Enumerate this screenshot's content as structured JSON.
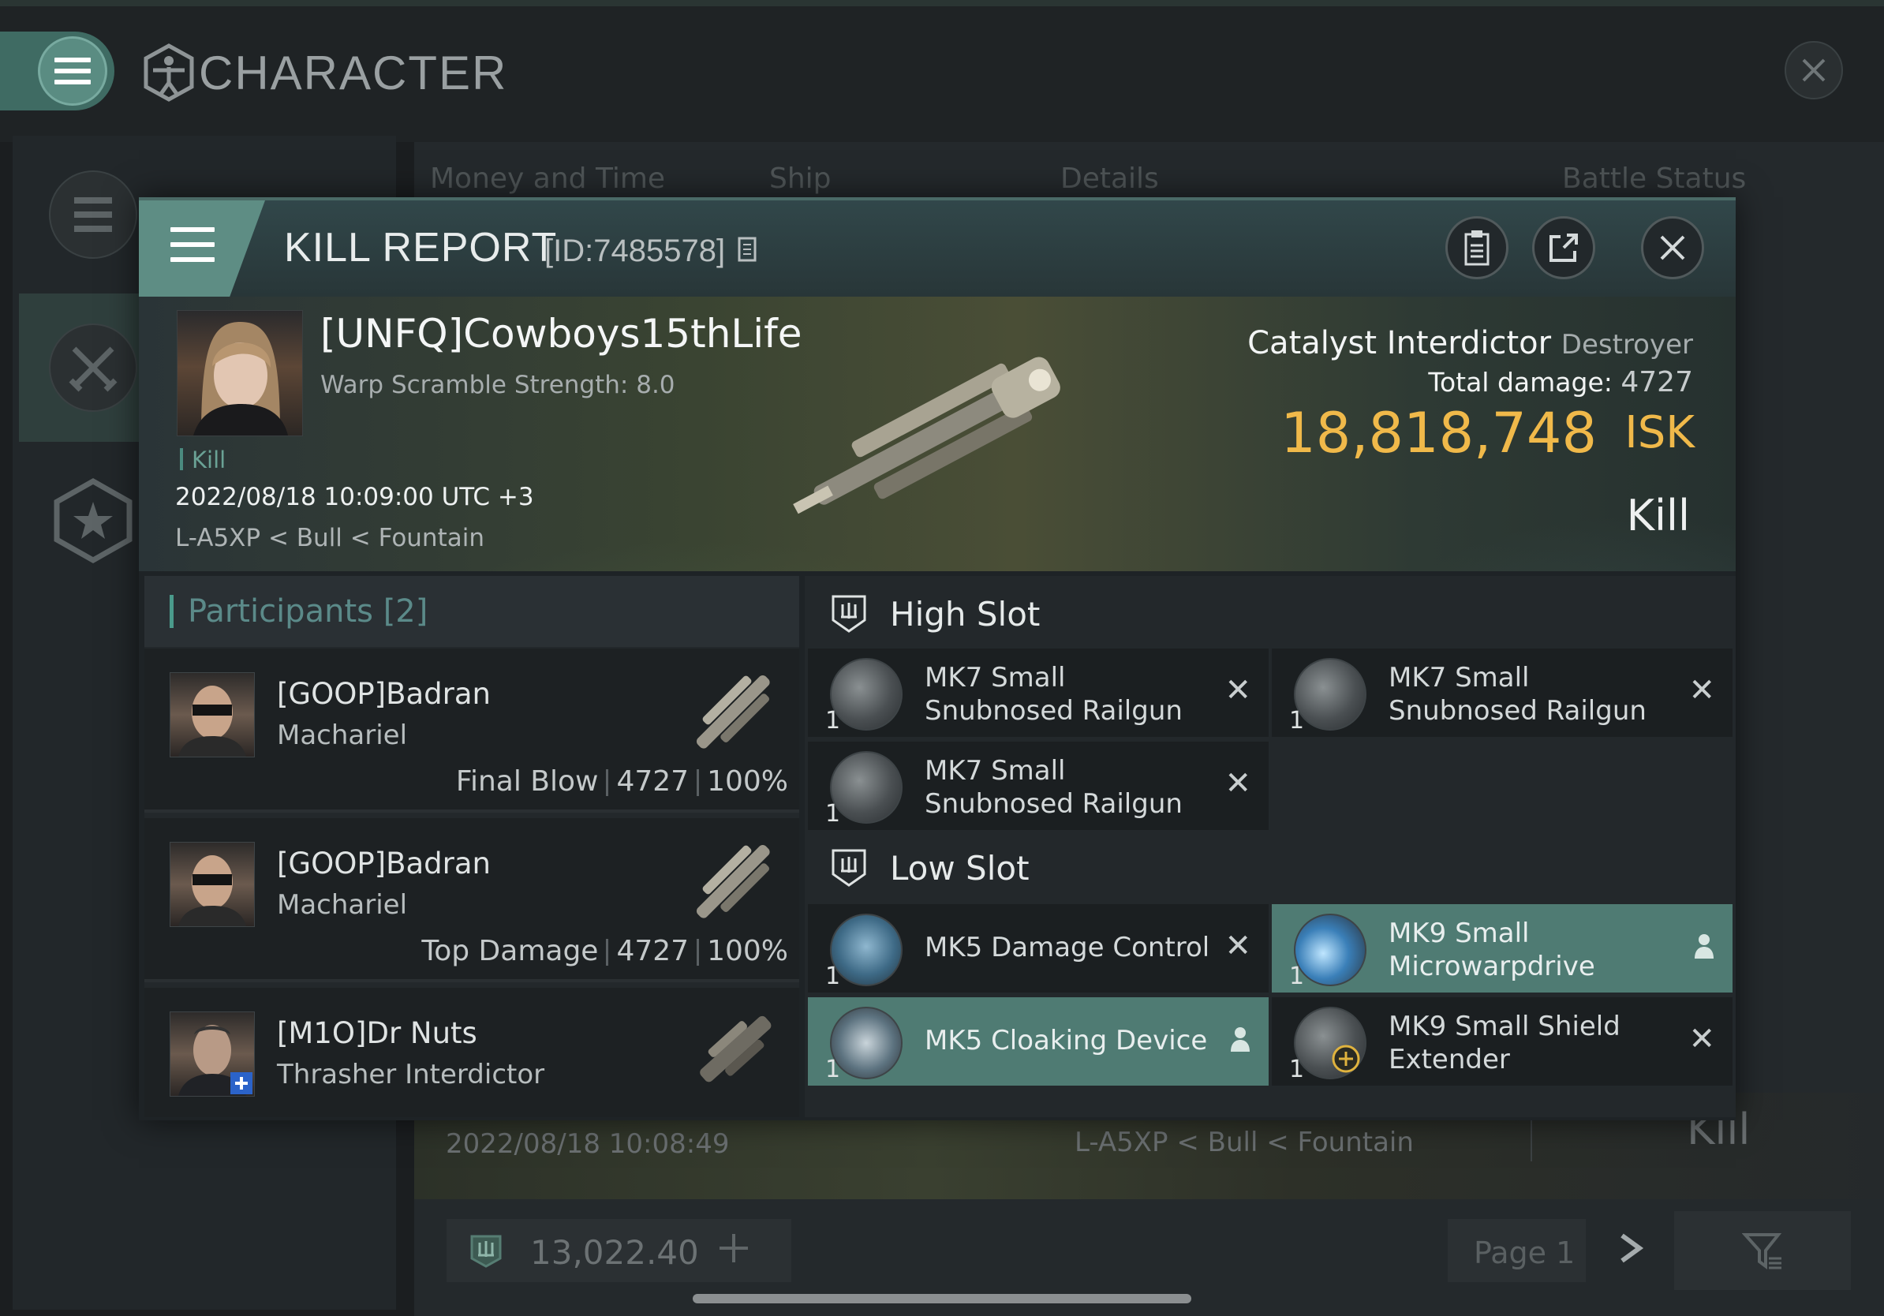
{
  "app": {
    "title": "CHARACTER",
    "tabs": [
      "Money and Time",
      "Ship",
      "Details",
      "Battle Status"
    ],
    "background_row": {
      "date": "2022/08/18  10:08:49",
      "location": "L-A5XP < Bull < Fountain",
      "status": "Kill"
    },
    "balance": "13,022.40",
    "page_label": "Page 1",
    "icons": {
      "menu": "hamburger-icon",
      "logo": "vitruvian-man-icon",
      "close": "close-icon",
      "list": "list-icon",
      "swords": "crossed-swords-icon",
      "star": "star-badge-icon",
      "balance": "wallet-icon",
      "add": "plus-icon",
      "next": "chevron-right-icon",
      "filter": "filter-icon"
    }
  },
  "kill_report": {
    "title": "KILL REPORT",
    "id_label": "[ID:7485578]",
    "victim": {
      "name": "[UNFQ]Cowboys15thLife",
      "warp_scramble": "Warp Scramble Strength: 8.0",
      "tag": "Kill",
      "datetime": "2022/08/18 10:09:00 UTC +3",
      "location": "L-A5XP < Bull < Fountain",
      "ship_name": "Catalyst Interdictor",
      "ship_class": "Destroyer",
      "total_damage_label": "Total damage:",
      "total_damage": "4727",
      "isk_value": "18,818,748",
      "isk_unit": "ISK",
      "result": "Kill"
    },
    "participants": {
      "title": "Participants",
      "count": "[2]",
      "rows": [
        {
          "name": "[GOOP]Badran",
          "ship": "Machariel",
          "role": "Final Blow",
          "damage": "4727",
          "percent": "100%"
        },
        {
          "name": "[GOOP]Badran",
          "ship": "Machariel",
          "role": "Top Damage",
          "damage": "4727",
          "percent": "100%"
        },
        {
          "name": "[M1O]Dr Nuts",
          "ship": "Thrasher Interdictor",
          "role": "",
          "damage": "",
          "percent": ""
        }
      ]
    },
    "slots": {
      "high": {
        "title": "High Slot",
        "items": [
          {
            "name": "MK7 Small Snubnosed Railgun",
            "qty": "1",
            "state": "destroyed"
          },
          {
            "name": "MK7 Small Snubnosed Railgun",
            "qty": "1",
            "state": "destroyed"
          },
          {
            "name": "MK7 Small Snubnosed Railgun",
            "qty": "1",
            "state": "destroyed"
          }
        ]
      },
      "low": {
        "title": "Low Slot",
        "items": [
          {
            "name": "MK5 Damage Control",
            "qty": "1",
            "state": "destroyed"
          },
          {
            "name": "MK9 Small Microwarpdrive",
            "qty": "1",
            "state": "dropped"
          },
          {
            "name": "MK5 Cloaking Device",
            "qty": "1",
            "state": "dropped"
          },
          {
            "name": "MK9 Small Shield Extender",
            "qty": "1",
            "state": "destroyed"
          }
        ]
      }
    },
    "colors": {
      "isk": "#f0b94a",
      "accent": "#5e8d84",
      "dropped_item": "#4f7b73"
    }
  }
}
